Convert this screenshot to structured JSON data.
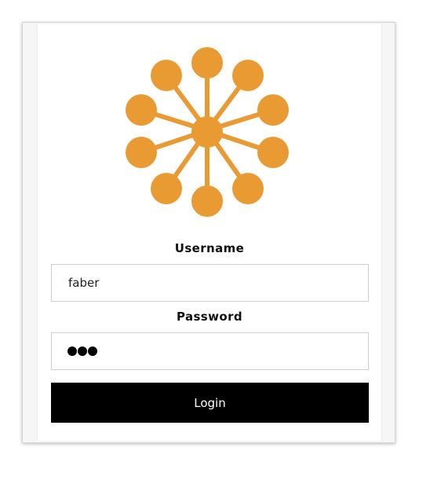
{
  "logo": {
    "icon": "hub-nodes-icon",
    "color": "#EA9A32"
  },
  "form": {
    "username_label": "Username",
    "username_value": "faber",
    "password_label": "Password",
    "password_masked_length": 3,
    "login_label": "Login"
  },
  "colors": {
    "accent": "#EA9A32",
    "button_bg": "#000000",
    "button_text": "#FFFFFF",
    "input_border": "#CFCFCF"
  }
}
